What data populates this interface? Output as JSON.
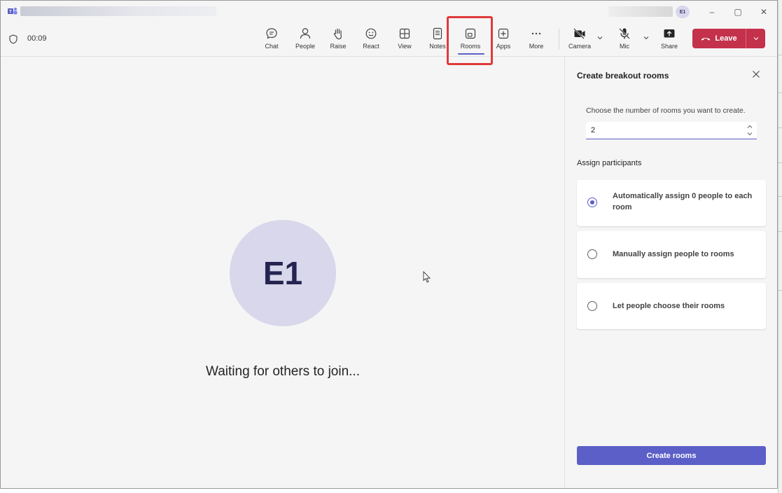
{
  "window": {
    "title": "Breakout rooms meeting",
    "avatar_initials": "E1",
    "controls": {
      "minimize": "–",
      "maximize": "▢",
      "close": "✕"
    }
  },
  "toolbar": {
    "timer": "00:09",
    "items": [
      {
        "label": "Chat",
        "icon": "chat-icon"
      },
      {
        "label": "People",
        "icon": "people-icon"
      },
      {
        "label": "Raise",
        "icon": "raise-hand-icon"
      },
      {
        "label": "React",
        "icon": "react-icon"
      },
      {
        "label": "View",
        "icon": "view-icon"
      },
      {
        "label": "Notes",
        "icon": "notes-icon"
      },
      {
        "label": "Rooms",
        "icon": "rooms-icon"
      },
      {
        "label": "Apps",
        "icon": "apps-icon"
      },
      {
        "label": "More",
        "icon": "more-icon"
      },
      {
        "label": "Camera",
        "icon": "camera-off-icon"
      },
      {
        "label": "Mic",
        "icon": "mic-off-icon"
      },
      {
        "label": "Share",
        "icon": "share-icon"
      }
    ],
    "active_item": "Rooms",
    "leave_label": "Leave",
    "leave_color": "#c4314b",
    "highlight_color": "#e03a3a"
  },
  "stage": {
    "avatar_initials": "E1",
    "status_text": "Waiting for others to join..."
  },
  "panel": {
    "title": "Create breakout rooms",
    "rooms_label": "Choose the number of rooms you want to create.",
    "rooms_value": "2",
    "assign_title": "Assign participants",
    "options": [
      {
        "label": "Automatically assign 0 people to each room",
        "selected": true
      },
      {
        "label": "Manually assign people to rooms",
        "selected": false
      },
      {
        "label": "Let people choose their rooms",
        "selected": false
      }
    ],
    "create_label": "Create rooms",
    "accent_color": "#5b5fc7"
  }
}
